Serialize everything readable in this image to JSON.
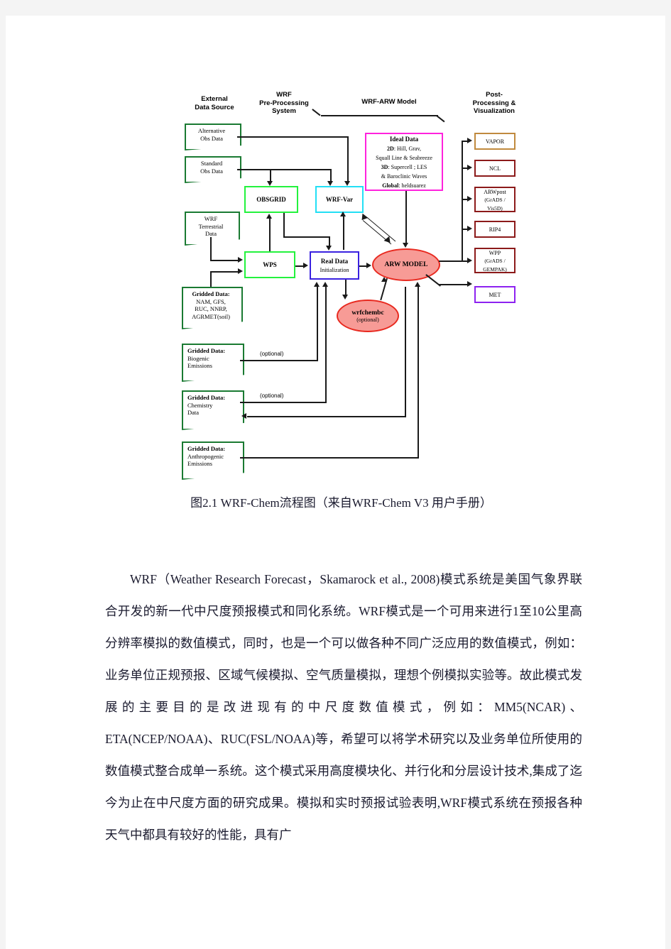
{
  "figure": {
    "headers": [
      {
        "id": "external-data-source",
        "text": "External\nData Source"
      },
      {
        "id": "wrf-preprocessing-system",
        "text": "WRF\nPre-Processing\nSystem"
      },
      {
        "id": "wrf-arw-model",
        "text": "WRF-ARW Model"
      },
      {
        "id": "post-processing-visualization",
        "text": "Post-\nProcessing &\nVisualization"
      }
    ],
    "sources": [
      {
        "id": "alternative-obs-data",
        "lines": [
          "Alternative",
          "Obs Data"
        ],
        "align": "center",
        "color": "#1a7a32"
      },
      {
        "id": "standard-obs-data",
        "lines": [
          "Standard",
          "Obs Data"
        ],
        "align": "center",
        "color": "#1a7a32"
      },
      {
        "id": "wrf-terrestrial-data",
        "lines": [
          "WRF",
          "Terrestrial",
          "Data"
        ],
        "align": "center",
        "color": "#1a7a32"
      },
      {
        "id": "gridded-data-meteorology",
        "title": "Gridded Data:",
        "lines": [
          "NAM, GFS,",
          "RUC, NNRP,",
          "AGRMET(soil)"
        ],
        "align": "center",
        "color": "#1a7a32"
      },
      {
        "id": "gridded-data-biogenic",
        "title": "Gridded Data:",
        "lines": [
          "Biogenic",
          "Emissions"
        ],
        "align": "left",
        "color": "#1a7a32"
      },
      {
        "id": "gridded-data-chemistry",
        "title": "Gridded Data:",
        "lines": [
          "Chemistry",
          "Data"
        ],
        "align": "left",
        "color": "#1a7a32"
      },
      {
        "id": "gridded-data-anthropogenic",
        "title": "Gridded Data:",
        "lines": [
          "Anthropogenic",
          "Emissions"
        ],
        "align": "left",
        "color": "#1a7a32"
      }
    ],
    "processes": [
      {
        "id": "obsgrid",
        "title": "OBSGRID",
        "color": "#23f23d"
      },
      {
        "id": "wrf-var",
        "title": "WRF-Var",
        "color": "#22dff5"
      },
      {
        "id": "wps",
        "title": "WPS",
        "color": "#23f23d"
      },
      {
        "id": "real-data-initialization",
        "title": "Real Data",
        "sub": "Initialization",
        "color": "#3a22e0"
      }
    ],
    "ideal_data": {
      "id": "ideal-data",
      "title": "Ideal Data",
      "color": "#ff22dd",
      "lines": [
        {
          "label": "2D:",
          "value": " Hill, Grav,"
        },
        {
          "label": "",
          "value": "Squall Line & Seabreeze"
        },
        {
          "label": "3D:",
          "value": " Supercell ; LES"
        },
        {
          "label": "",
          "value": "& Baroclinic Waves"
        },
        {
          "label": "Global:",
          "value": " heldsuarez"
        }
      ]
    },
    "models": [
      {
        "id": "arw-model",
        "name": "ARW MODEL",
        "optional": "",
        "fill": "#f79b96",
        "border": "#e8291f"
      },
      {
        "id": "wrfchembc",
        "name": "wrfchembc",
        "optional": "(optional)",
        "fill": "#f79b96",
        "border": "#e8291f"
      }
    ],
    "outputs": [
      {
        "id": "vapor",
        "title": "VAPOR",
        "sub": "",
        "color": "#c08a3e"
      },
      {
        "id": "ncl",
        "title": "NCL",
        "sub": "",
        "color": "#8c1a1a"
      },
      {
        "id": "arwpost",
        "title": "ARWpost",
        "sub": "(GrADS /\nVis5D)",
        "color": "#8c1a1a"
      },
      {
        "id": "rip4",
        "title": "RIP4",
        "sub": "",
        "color": "#8c1a1a"
      },
      {
        "id": "wpp",
        "title": "WPP",
        "sub": "(GrADS /\nGEMPAK)",
        "color": "#8c1a1a"
      },
      {
        "id": "met",
        "title": "MET",
        "sub": "",
        "color": "#8d22f0"
      }
    ],
    "optional_labels": [
      "(optional)",
      "(optional)"
    ]
  },
  "caption": "图2.1 WRF-Chem流程图（来自WRF-Chem V3  用户手册）",
  "body_paragraph": "WRF（Weather Research Forecast，Skamarock et al., 2008)模式系统是美国气象界联合开发的新一代中尺度预报模式和同化系统。WRF模式是一个可用来进行1至10公里高分辨率模拟的数值模式，同时，也是一个可以做各种不同广泛应用的数值模式，例如：业务单位正规预报、区域气候模拟、空气质量模拟，理想个例模拟实验等。故此模式发展的主要目的是改进现有的中尺度数值模式，例如：MM5(NCAR)、ETA(NCEP/NOAA)、RUC(FSL/NOAA)等，希望可以将学术研究以及业务单位所使用的数值模式整合成单一系统。这个模式采用高度模块化、并行化和分层设计技术,集成了迄今为止在中尺度方面的研究成果。模拟和实时预报试验表明,WRF模式系统在预报各种天气中都具有较好的性能，具有广"
}
